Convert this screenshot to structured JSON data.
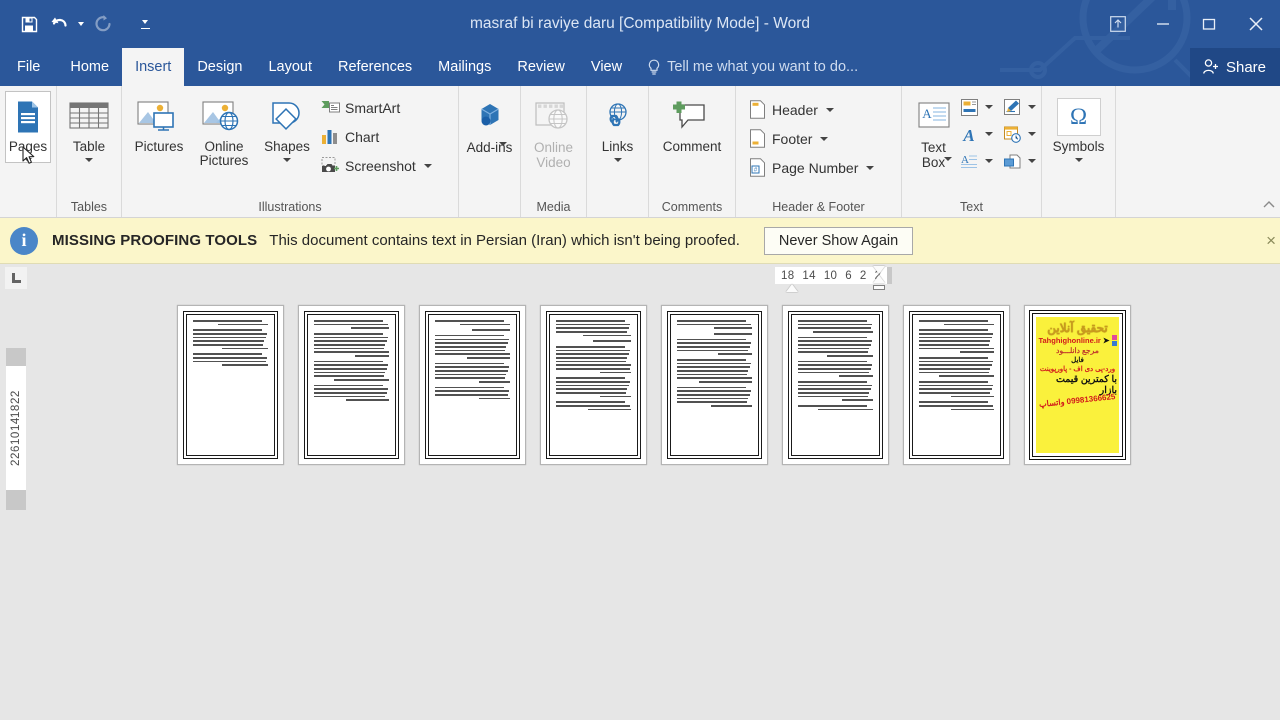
{
  "titlebar": {
    "document_title": "masraf bi raviye daru [Compatibility Mode] - Word",
    "quick_access": [
      {
        "name": "save",
        "label": "Save",
        "icon": "save-icon",
        "enabled": true
      },
      {
        "name": "undo",
        "label": "Undo",
        "icon": "undo-icon",
        "enabled": true
      },
      {
        "name": "redo",
        "label": "Redo",
        "icon": "redo-icon",
        "enabled": false
      },
      {
        "name": "customize",
        "label": "Customize Quick Access Toolbar",
        "icon": "chevron-down-icon",
        "enabled": true
      }
    ],
    "window_controls": {
      "ribbon_display": "Ribbon Display Options",
      "minimize": "–",
      "restore": "❐",
      "close": "✕"
    }
  },
  "tabs": [
    {
      "label": "File",
      "active": false
    },
    {
      "label": "Home",
      "active": false
    },
    {
      "label": "Insert",
      "active": true
    },
    {
      "label": "Design",
      "active": false
    },
    {
      "label": "Layout",
      "active": false
    },
    {
      "label": "References",
      "active": false
    },
    {
      "label": "Mailings",
      "active": false
    },
    {
      "label": "Review",
      "active": false
    },
    {
      "label": "View",
      "active": false
    }
  ],
  "tellme": {
    "placeholder": "Tell me what you want to do..."
  },
  "share": {
    "label": "Share"
  },
  "ribbon": {
    "groups": [
      {
        "label": "",
        "buttons": [
          {
            "label": "Pages",
            "icon": "pages-icon",
            "has_dropdown": true,
            "state": "hover"
          }
        ]
      },
      {
        "label": "Tables",
        "buttons": [
          {
            "label": "Table",
            "icon": "table-icon",
            "has_dropdown": true,
            "state": "normal"
          }
        ]
      },
      {
        "label": "Illustrations",
        "buttons": [
          {
            "label": "Pictures",
            "icon": "pictures-icon",
            "has_dropdown": false,
            "state": "normal"
          },
          {
            "label": "Online Pictures",
            "icon": "online-pictures-icon",
            "has_dropdown": false,
            "state": "normal"
          },
          {
            "label": "Shapes",
            "icon": "shapes-icon",
            "has_dropdown": true,
            "state": "normal"
          }
        ],
        "small_buttons": [
          {
            "label": "SmartArt",
            "icon": "smartart-icon",
            "has_dropdown": false
          },
          {
            "label": "Chart",
            "icon": "chart-icon",
            "has_dropdown": false
          },
          {
            "label": "Screenshot",
            "icon": "screenshot-icon",
            "has_dropdown": true
          }
        ]
      },
      {
        "label": "",
        "buttons": [
          {
            "label": "Add-ins",
            "icon": "addins-icon",
            "has_dropdown": true,
            "state": "normal"
          }
        ]
      },
      {
        "label": "Media",
        "buttons": [
          {
            "label": "Online Video",
            "icon": "online-video-icon",
            "has_dropdown": false,
            "state": "disabled"
          }
        ]
      },
      {
        "label": "",
        "buttons": [
          {
            "label": "Links",
            "icon": "links-icon",
            "has_dropdown": true,
            "state": "normal"
          }
        ]
      },
      {
        "label": "Comments",
        "buttons": [
          {
            "label": "Comment",
            "icon": "comment-icon",
            "has_dropdown": false,
            "state": "normal"
          }
        ]
      },
      {
        "label": "Header & Footer",
        "small_buttons": [
          {
            "label": "Header",
            "icon": "header-icon",
            "has_dropdown": true
          },
          {
            "label": "Footer",
            "icon": "footer-icon",
            "has_dropdown": true
          },
          {
            "label": "Page Number",
            "icon": "page-number-icon",
            "has_dropdown": true
          }
        ]
      },
      {
        "label": "Text",
        "buttons": [
          {
            "label": "Text Box",
            "icon": "text-box-icon",
            "has_dropdown": true,
            "state": "normal"
          }
        ],
        "gallery_icons": [
          "quick-parts-icon",
          "signature-line-icon",
          "wordart-icon",
          "date-time-icon",
          "drop-cap-icon",
          "object-icon"
        ]
      },
      {
        "label": "",
        "buttons": [
          {
            "label": "Symbols",
            "icon": "omega-icon",
            "has_dropdown": true,
            "state": "normal"
          }
        ]
      }
    ],
    "collapse_label": "Collapse the Ribbon"
  },
  "message_bar": {
    "icon": "info-icon",
    "title": "MISSING PROOFING TOOLS",
    "text": "This document contains text in Persian (Iran) which isn't being proofed.",
    "button_label": "Never Show Again",
    "close_label": "×",
    "bg_color": "#fbf6ca"
  },
  "rulers": {
    "tab_selector": "L",
    "horizontal_ticks": [
      "18",
      "14",
      "10",
      "6",
      "2",
      "2"
    ],
    "vertical_ticks": [
      "2",
      "2",
      "6",
      "10",
      "14",
      "18",
      "22"
    ]
  },
  "document": {
    "zoom_view": "multiple-pages",
    "page_count": 8,
    "pages": [
      {
        "index": 1,
        "type": "text",
        "paragraphs": [
          2,
          6,
          4
        ]
      },
      {
        "index": 2,
        "type": "text",
        "paragraphs": [
          3,
          7,
          6,
          5
        ]
      },
      {
        "index": 3,
        "type": "text",
        "paragraphs": [
          2,
          1,
          7,
          6,
          4
        ]
      },
      {
        "index": 4,
        "type": "text",
        "paragraphs": [
          5,
          1,
          8,
          6,
          3
        ]
      },
      {
        "index": 5,
        "type": "text",
        "paragraphs": [
          3,
          1,
          5,
          7,
          6
        ]
      },
      {
        "index": 6,
        "type": "text",
        "paragraphs": [
          4,
          6,
          5,
          6,
          2
        ]
      },
      {
        "index": 7,
        "type": "text",
        "paragraphs": [
          2,
          7,
          6,
          5,
          3
        ]
      },
      {
        "index": 8,
        "type": "advertisement"
      }
    ],
    "ad_page": {
      "line1": "تحقیق آنلاین",
      "line2": "Tahghighonline.ir",
      "line3": "مرجع دانلـــود",
      "line4": "فایل",
      "line5": "ورد-پی دی اف - پاورپوینت",
      "line6": "با کمترین قیمت بازار",
      "line7": "09981366625 واتساپ",
      "bg_color": "#faf13c"
    }
  },
  "theme": {
    "accent": "#2b579a",
    "accent_dark": "#204886",
    "ribbon_bg": "#f4f4f4",
    "canvas_bg": "#e6e6e6"
  }
}
